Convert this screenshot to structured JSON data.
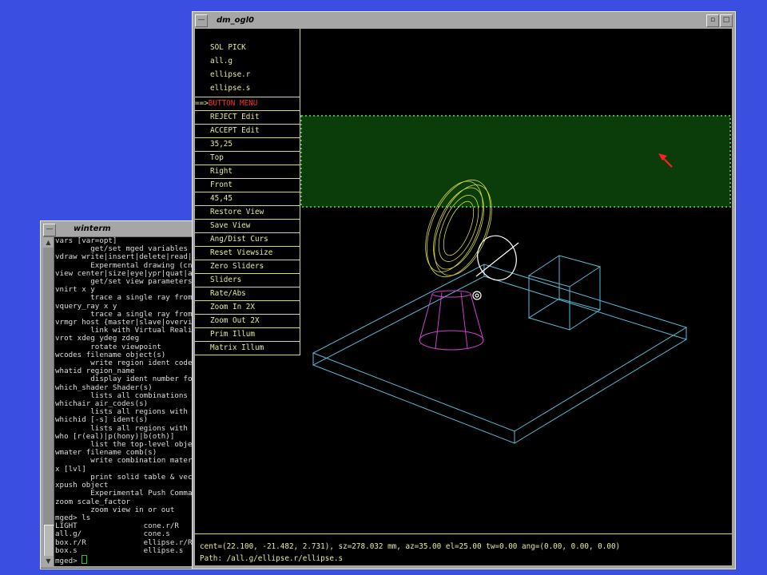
{
  "winterm": {
    "title": "winterm",
    "menu_glyph": "—",
    "scroll_up": "▲",
    "scroll_down": "▼",
    "lines": [
      "vars [var=opt]",
      "        get/set mged variables",
      "vdraw write|insert|delete|read|",
      "        Expermental drawing (cnu",
      "view center|size|eye|ypr|quat|ar",
      "        get/set view parameters",
      "vnirt x y",
      "        trace a single ray from",
      "vquery_ray x y",
      "        trace a single ray from",
      "vrmgr host {master|slave|overvie",
      "        link with Virtual Reali",
      "vrot xdeg ydeg zdeg",
      "        rotate viewpoint",
      "wcodes filename object(s)",
      "        write region ident codes",
      "whatid region_name",
      "        display ident number for",
      "which_shader Shader(s)",
      "        lists all combinations u",
      "whichair air_codes(s)",
      "        lists all regions with g",
      "whichid [-s] ident(s)",
      "        lists all regions with g",
      "who [r(eal)|p(hony)|b(oth)]",
      "        list the top-level objec",
      "wmater filename comb(s)",
      "        write combination mater",
      "x [lvl]",
      "        print solid table & vect",
      "xpush object",
      "        Experimental Push Comman",
      "zoom scale_factor",
      "        zoom view in or out",
      "mged> ls",
      "LIGHT               cone.r/R",
      "all.g/              cone.s",
      "box.r/R             ellipse.r/R",
      "box.s               ellipse.s"
    ],
    "prompt": "mged> "
  },
  "glwindow": {
    "title": "dm_ogl0",
    "menu_glyph": "—",
    "minimize_glyph": "▫",
    "maximize_glyph": "□",
    "header": [
      "SOL PICK",
      "all.g",
      "ellipse.r",
      "ellipse.s"
    ],
    "selected_marker": "==>",
    "menu_items": [
      "BUTTON MENU",
      "REJECT Edit",
      "ACCEPT Edit",
      "35,25",
      "Top",
      "Right",
      "Front",
      "45,45",
      "Restore View",
      "Save View",
      "Ang/Dist Curs",
      "Reset Viewsize",
      "Zero Sliders",
      "Sliders",
      "Rate/Abs",
      "Zoom In 2X",
      "Zoom Out 2X",
      "Prim Illum",
      "Matrix Illum"
    ],
    "status_line": "cent=(22.100, -21.482, 2.731), sz=278.032 mm, az=35.00 el=25.00 tw=0.00 ang=(0.00, 0.00, 0.00)",
    "path_line": "Path: /all.g/ellipse.r/ellipse.s"
  },
  "colors": {
    "desktop": "#3a4fe0",
    "menu_text": "#e8e8a0",
    "selected_item": "#ff3030",
    "selection_rect": "#1e8a1e",
    "box_wire": "#5bbcd6",
    "torus_wire": "#d8d840",
    "cone_wire": "#d040d0",
    "ellipse_wire": "#ffffff"
  },
  "icons": {
    "pointer": "red-arrow-icon"
  }
}
